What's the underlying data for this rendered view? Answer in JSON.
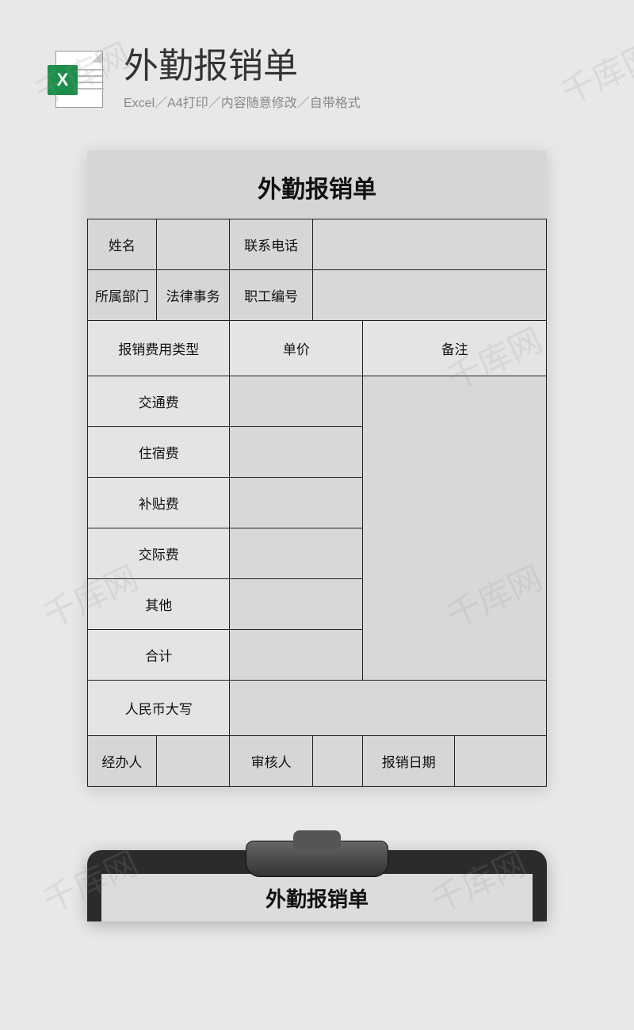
{
  "header": {
    "title": "外勤报销单",
    "subtitle": "Excel／A4打印／内容随意修改／自带格式",
    "icon_letter": "X"
  },
  "form": {
    "title": "外勤报销单",
    "row1": {
      "name_label": "姓名",
      "name_value": "",
      "phone_label": "联系电话",
      "phone_value": ""
    },
    "row2": {
      "dept_label": "所属部门",
      "dept_value": "法律事务",
      "empno_label": "职工编号",
      "empno_value": ""
    },
    "header_row": {
      "type_label": "报销费用类型",
      "price_label": "单价",
      "remark_label": "备注"
    },
    "items": [
      {
        "label": "交通费",
        "price": ""
      },
      {
        "label": "住宿费",
        "price": ""
      },
      {
        "label": "补贴费",
        "price": ""
      },
      {
        "label": "交际费",
        "price": ""
      },
      {
        "label": "其他",
        "price": ""
      },
      {
        "label": "合计",
        "price": ""
      }
    ],
    "rmb_label": "人民币大写",
    "rmb_value": "",
    "footer": {
      "handler_label": "经办人",
      "handler_value": "",
      "reviewer_label": "审核人",
      "reviewer_value": "",
      "date_label": "报销日期",
      "date_value": ""
    }
  },
  "bottom_preview_title": "外勤报销单",
  "watermark_text": "千库网"
}
